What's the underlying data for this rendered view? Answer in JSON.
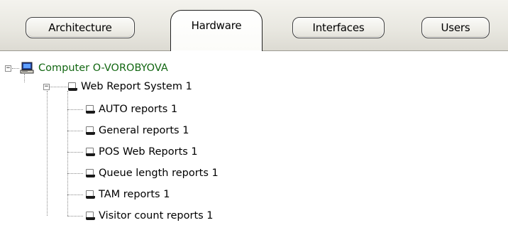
{
  "tabs": [
    {
      "label": "Architecture",
      "active": false
    },
    {
      "label": "Hardware",
      "active": true
    },
    {
      "label": "Interfaces",
      "active": false
    },
    {
      "label": "Users",
      "active": false
    }
  ],
  "tree": {
    "root": {
      "label": "Computer O-VOROBYOVA",
      "icon": "computer-icon",
      "expanded": true
    },
    "system": {
      "label": "Web Report System 1",
      "icon": "object-icon",
      "expanded": true
    },
    "children": [
      {
        "label": "AUTO reports 1",
        "icon": "object-icon"
      },
      {
        "label": "General reports 1",
        "icon": "object-icon"
      },
      {
        "label": "POS Web Reports 1",
        "icon": "object-icon"
      },
      {
        "label": "Queue length reports 1",
        "icon": "object-icon"
      },
      {
        "label": "TAM reports 1",
        "icon": "object-icon"
      },
      {
        "label": "Visitor count reports 1",
        "icon": "object-icon"
      }
    ]
  },
  "colors": {
    "root_label": "#116611",
    "tab_border": "#3f3f3f",
    "tabbar_bg": "#e9e8e1"
  }
}
